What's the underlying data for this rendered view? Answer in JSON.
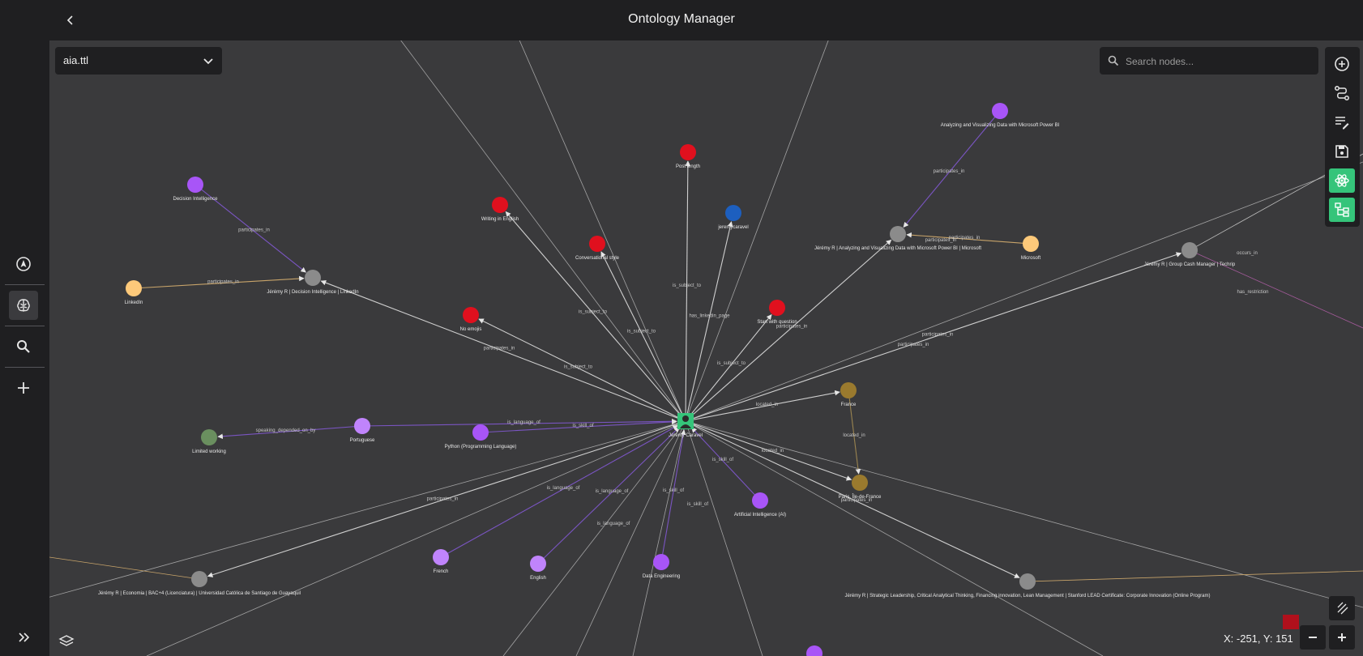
{
  "app": {
    "title": "Ontology Manager"
  },
  "file_select": {
    "value": "aia.ttl"
  },
  "search": {
    "placeholder": "Search nodes..."
  },
  "coords": {
    "text": "X: -251, Y: 151"
  },
  "colors": {
    "person": "#8b8b8b",
    "skill": "#a855f7",
    "language": "#c084fc",
    "rule": "#e0101e",
    "place": "#9a7a2e",
    "org": "#fdc97a",
    "level": "#6a8f5f",
    "contact": "#1d5fbf",
    "accent": "#35c47a"
  },
  "leftbar": {
    "items": [
      {
        "icon": "navigate-icon"
      },
      {
        "icon": "brain-icon",
        "active": true
      },
      {
        "icon": "search-icon"
      },
      {
        "icon": "plus-icon"
      }
    ],
    "expand_icon": "double-chevron-right-icon"
  },
  "toolbar": [
    "add-node-icon",
    "add-relation-icon",
    "edit-list-icon",
    "save-icon",
    "atom-icon",
    "hierarchy-icon"
  ],
  "graph": {
    "nodes": [
      {
        "id": "jeremy",
        "label": "Jérémy Caravel",
        "type": "center"
      },
      {
        "id": "post",
        "label": "Post length",
        "type": "rule"
      },
      {
        "id": "writing",
        "label": "Writing in English",
        "type": "rule"
      },
      {
        "id": "conv",
        "label": "Conversational style",
        "type": "rule"
      },
      {
        "id": "noemoji",
        "label": "No emojis",
        "type": "rule"
      },
      {
        "id": "startq",
        "label": "Start with question",
        "type": "rule"
      },
      {
        "id": "jeremycaravel",
        "label": "jeremycaravel",
        "type": "contact"
      },
      {
        "id": "decint",
        "label": "Decision Intelligence",
        "type": "skill"
      },
      {
        "id": "jrdec",
        "label": "Jérémy R | Decision Intelligence | LinkedIn",
        "type": "person"
      },
      {
        "id": "linkedin",
        "label": "LinkedIn",
        "type": "org"
      },
      {
        "id": "powerbi",
        "label": "Analyzing and Visualizing Data with Microsoft Power BI",
        "type": "skill"
      },
      {
        "id": "jrpowerbi",
        "label": "Jérémy R | Analyzing and Visualizing Data with Microsoft Power BI | Microsoft",
        "type": "person"
      },
      {
        "id": "microsoft",
        "label": "Microsoft",
        "type": "org"
      },
      {
        "id": "jrcash",
        "label": "Jérémy R | Group Cash Manager | Techrip",
        "type": "person"
      },
      {
        "id": "france",
        "label": "France",
        "type": "place"
      },
      {
        "id": "paris",
        "label": "Paris, Île-de-France",
        "type": "place"
      },
      {
        "id": "portuguese",
        "label": "Portuguese",
        "type": "language"
      },
      {
        "id": "limited",
        "label": "Limited working",
        "type": "level"
      },
      {
        "id": "python",
        "label": "Python (Programming Language)",
        "type": "skill"
      },
      {
        "id": "ai",
        "label": "Artificial Intelligence (AI)",
        "type": "skill"
      },
      {
        "id": "french",
        "label": "French",
        "type": "language"
      },
      {
        "id": "english",
        "label": "English",
        "type": "language"
      },
      {
        "id": "dataeng",
        "label": "Data Engineering",
        "type": "skill"
      },
      {
        "id": "jreco",
        "label": "Jérémy R | Economia | BAC+4 (Licenciatura) | Universidad Católica de Santiago de Guayaquil",
        "type": "person"
      },
      {
        "id": "jrstan",
        "label": "Jérémy R | Strategic Leadership, Critical Analytical Thinking, Financing innovation, Lean Management | Stanford LEAD Certificate: Corporate Innovation (Online Program)",
        "type": "person"
      }
    ],
    "edge_labels": [
      "participates_in",
      "participates_in",
      "participates_in",
      "participates_in",
      "participates_in",
      "participates_in",
      "participates_in",
      "participates_in",
      "participates_in",
      "participates_in",
      "participates_in",
      "is_subject_to",
      "is_subject_to",
      "is_subject_to",
      "is_subject_to",
      "is_subject_to",
      "has_linkedin_page",
      "located_in",
      "located_in",
      "located_in",
      "is_language_of",
      "is_language_of",
      "is_language_of",
      "is_language_of",
      "is_skill_of",
      "is_skill_of",
      "is_skill_of",
      "is_skill_of",
      "speaking_depended_on_by",
      "occurs_in",
      "has_restriction"
    ]
  }
}
